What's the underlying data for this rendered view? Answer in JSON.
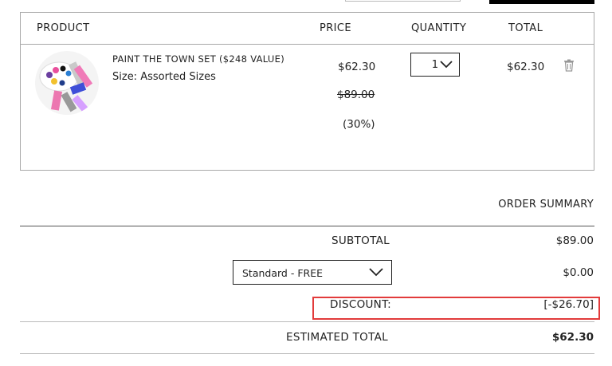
{
  "table": {
    "headers": {
      "product": "PRODUCT",
      "price": "PRICE",
      "quantity": "QUANTITY",
      "total": "TOTAL"
    },
    "item": {
      "name": "PAINT THE TOWN SET ($248 VALUE)",
      "size": "Size: Assorted Sizes",
      "price": "$62.30",
      "original_price": "$89.00",
      "discount_percent": "(30%)",
      "quantity": "1",
      "total": "$62.30",
      "image_icon": "product-palette-image",
      "delete_icon": "trash-icon"
    }
  },
  "summary": {
    "title": "ORDER SUMMARY",
    "subtotal_label": "SUBTOTAL",
    "subtotal_value": "$89.00",
    "shipping_option": "Standard - FREE",
    "shipping_value": "$0.00",
    "discount_label": "DISCOUNT:",
    "discount_value": "[-$26.70]",
    "estimated_total_label": "ESTIMATED TOTAL",
    "estimated_total_value": "$62.30"
  },
  "colors": {
    "highlight": "#e23b3b",
    "border": "#a9a9a9"
  }
}
